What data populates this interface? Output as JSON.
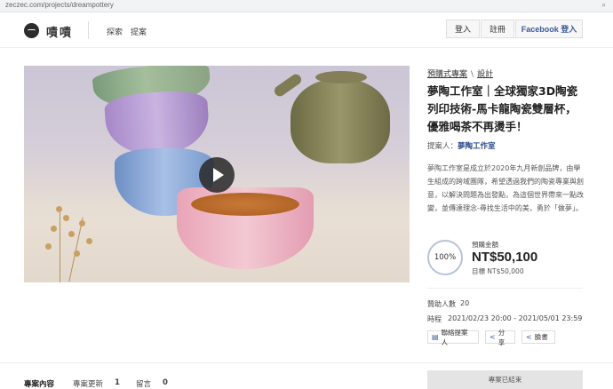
{
  "browser": {
    "url": "zeczec.com/projects/dreampottery",
    "zoom_icon": "zoom-icon"
  },
  "nav": {
    "logo_text": "嘖嘖",
    "explore": "探索",
    "propose": "提案",
    "login": "登入",
    "signup": "註冊",
    "facebook_login": "Facebook 登入"
  },
  "breadcrumb": {
    "category": "預購式專案",
    "subcategory": "設計"
  },
  "project": {
    "title": "夢陶工作室｜全球獨家3D陶瓷列印技術-馬卡龍陶瓷雙層杯，優雅喝茶不再燙手！",
    "proposer_label": "提案人",
    "proposer_name": "夢陶工作室",
    "description": "夢陶工作室是成立於2020年九月新創品牌，由學生組成的跨域團隊，希望透過我們的陶瓷專業與創意，以解決問題為出發點，為這個世界帶來一點改變，並傳達理念-尋找生活中的美，勇於「做夢」。"
  },
  "funding": {
    "percent": "100%",
    "raised_label": "預購金額",
    "raised": "NT$50,100",
    "goal": "目標 NT$50,000"
  },
  "stats": {
    "backers_label": "贊助人數",
    "backers": "20",
    "time_label": "時程",
    "time": "2021/02/23 20:00 - 2021/05/01 23:59"
  },
  "actions": {
    "contact": "聯絡提案人",
    "share": "分享",
    "fb_share": "臉書"
  },
  "tabs": {
    "content": "專案內容",
    "updates": "專案更新",
    "updates_count": "1",
    "comments": "留言",
    "comments_count": "0"
  },
  "status_button": "專案已結束",
  "colors": {
    "accent": "#3b5998",
    "link": "#2b4a8a",
    "ring": "#b8c3da"
  }
}
